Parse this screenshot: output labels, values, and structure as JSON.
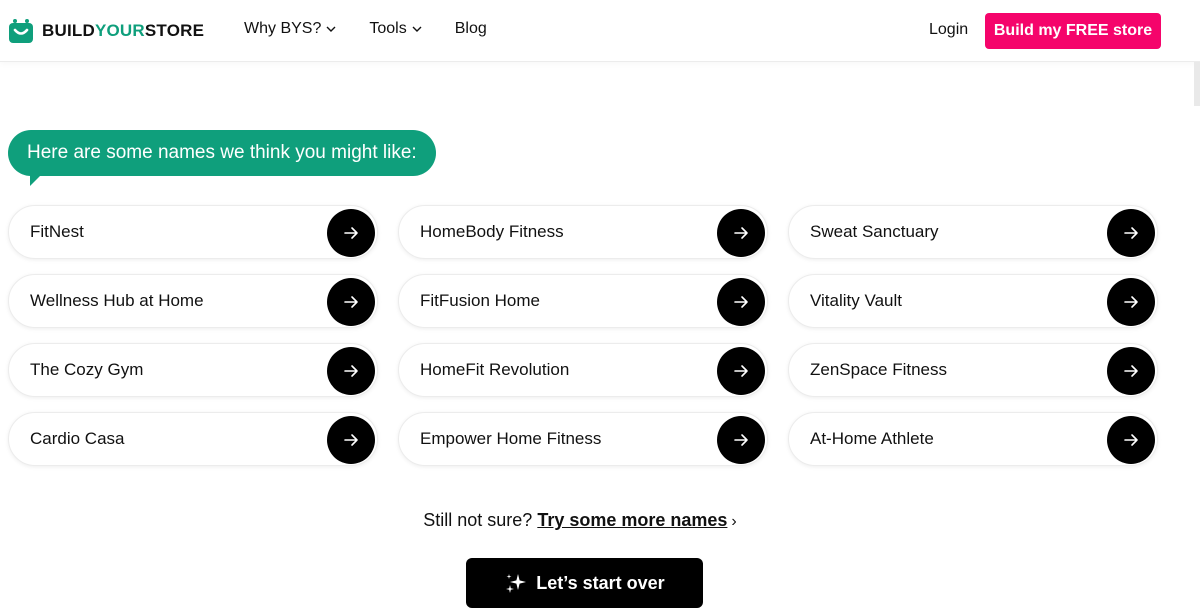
{
  "header": {
    "logo": {
      "part1": "BUILD",
      "part2": "YOUR",
      "part3": "STORE"
    },
    "nav": [
      {
        "label": "Why BYS?",
        "has_dropdown": true
      },
      {
        "label": "Tools",
        "has_dropdown": true
      },
      {
        "label": "Blog",
        "has_dropdown": false
      }
    ],
    "login_label": "Login",
    "cta_label": "Build my FREE store"
  },
  "bubble_text": "Here are some names we think you might like:",
  "names": [
    "FitNest",
    "HomeBody Fitness",
    "Sweat Sanctuary",
    "Wellness Hub at Home",
    "FitFusion Home",
    "Vitality Vault",
    "The Cozy Gym",
    "HomeFit Revolution",
    "ZenSpace Fitness",
    "Cardio Casa",
    "Empower Home Fitness",
    "At-Home Athlete"
  ],
  "more": {
    "prefix": "Still not sure?",
    "link": "Try some more names",
    "caret": "›"
  },
  "restart_label": "Let’s start over",
  "colors": {
    "brand_green": "#0f9f7c",
    "cta_pink": "#f5046b",
    "button_black": "#000000"
  },
  "icons": {
    "logo": "shopping-bag-icon",
    "arrow": "arrow-right-icon",
    "sparkle": "sparkle-icon",
    "chevron": "chevron-down-icon"
  }
}
